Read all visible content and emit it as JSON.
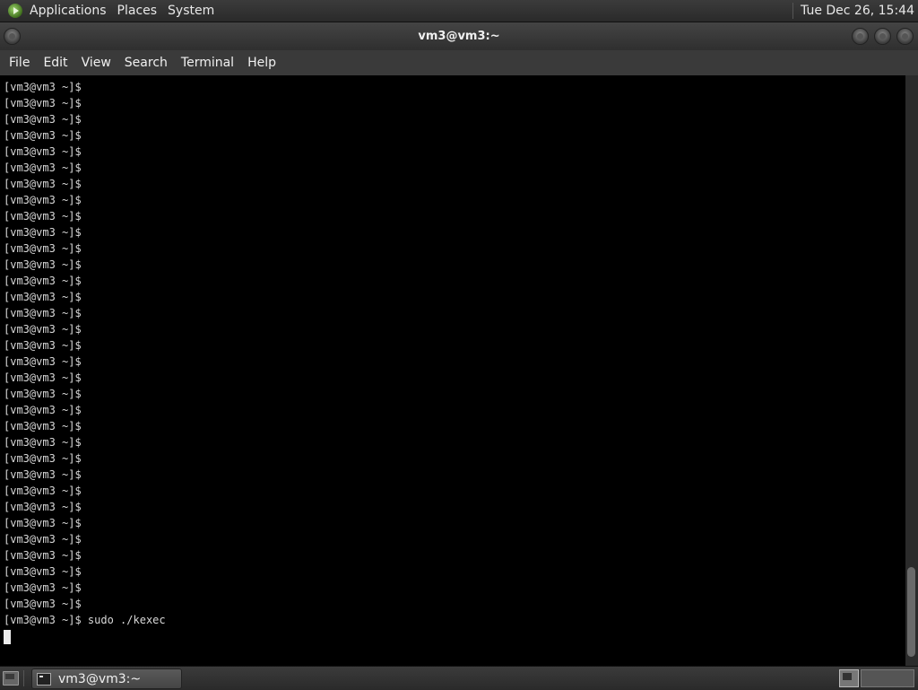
{
  "top_panel": {
    "menus": [
      "Applications",
      "Places",
      "System"
    ],
    "clock": "Tue Dec 26, 15:44"
  },
  "window": {
    "title": "vm3@vm3:~"
  },
  "menubar": {
    "items": [
      "File",
      "Edit",
      "View",
      "Search",
      "Terminal",
      "Help"
    ]
  },
  "terminal": {
    "lines": [
      "[vm3@vm3 ~]$",
      "[vm3@vm3 ~]$",
      "[vm3@vm3 ~]$",
      "[vm3@vm3 ~]$",
      "[vm3@vm3 ~]$",
      "[vm3@vm3 ~]$",
      "[vm3@vm3 ~]$",
      "[vm3@vm3 ~]$",
      "[vm3@vm3 ~]$",
      "[vm3@vm3 ~]$",
      "[vm3@vm3 ~]$",
      "[vm3@vm3 ~]$",
      "[vm3@vm3 ~]$",
      "[vm3@vm3 ~]$",
      "[vm3@vm3 ~]$",
      "[vm3@vm3 ~]$",
      "[vm3@vm3 ~]$",
      "[vm3@vm3 ~]$",
      "[vm3@vm3 ~]$",
      "[vm3@vm3 ~]$",
      "[vm3@vm3 ~]$",
      "[vm3@vm3 ~]$",
      "[vm3@vm3 ~]$",
      "[vm3@vm3 ~]$",
      "[vm3@vm3 ~]$",
      "[vm3@vm3 ~]$",
      "[vm3@vm3 ~]$",
      "[vm3@vm3 ~]$",
      "[vm3@vm3 ~]$",
      "[vm3@vm3 ~]$",
      "[vm3@vm3 ~]$",
      "[vm3@vm3 ~]$",
      "[vm3@vm3 ~]$",
      "[vm3@vm3 ~]$ sudo ./kexec"
    ]
  },
  "taskbar": {
    "task_label": "vm3@vm3:~"
  },
  "icons": {
    "app_logo": "fedora-logo-icon",
    "show_desktop": "show-desktop-icon",
    "terminal": "terminal-icon",
    "workspace": "workspace-switcher-icon"
  }
}
